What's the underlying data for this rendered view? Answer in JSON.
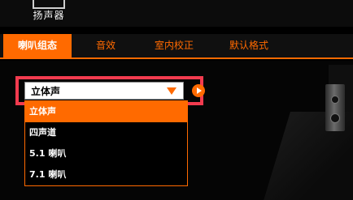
{
  "device": {
    "icon": "speaker-icon",
    "label": "扬声器"
  },
  "tabs": [
    {
      "label": "喇叭组态",
      "active": true
    },
    {
      "label": "音效",
      "active": false
    },
    {
      "label": "室内校正",
      "active": false
    },
    {
      "label": "默认格式",
      "active": false
    }
  ],
  "speaker_config": {
    "selected": "立体声",
    "options": [
      "立体声",
      "四声道",
      "5.1 喇叭",
      "7.1 喇叭"
    ]
  },
  "colors": {
    "accent": "#ff6a00",
    "highlight": "#f33b4f"
  }
}
